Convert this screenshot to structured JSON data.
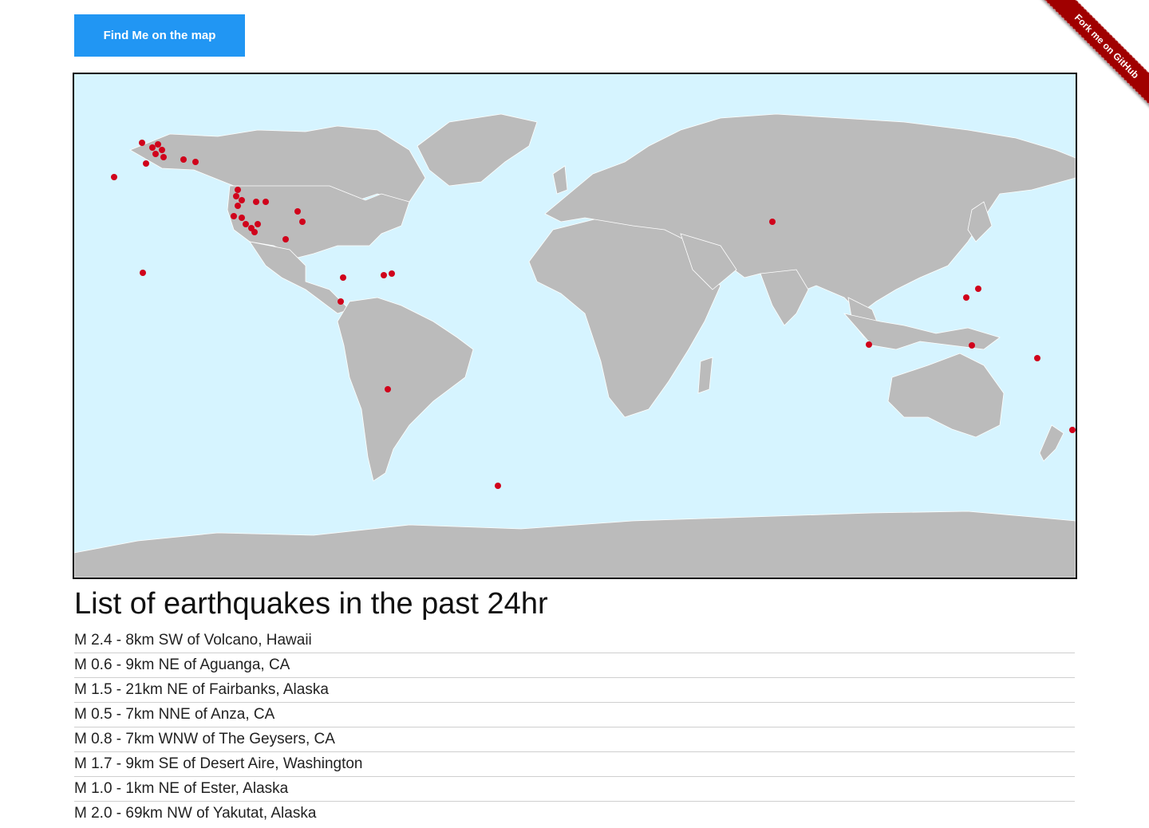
{
  "find_button": {
    "label": "Find Me on the map"
  },
  "ribbon": {
    "label": "Fork me on GitHub"
  },
  "map": {
    "ocean_color": "#d6f4ff",
    "land_color": "#bbbbbb",
    "marker_color": "#d0021b"
  },
  "list": {
    "title": "List of earthquakes in the past 24hr",
    "items": [
      "M 2.4 - 8km SW of Volcano, Hawaii",
      "M 0.6 - 9km NE of Aguanga, CA",
      "M 1.5 - 21km NE of Fairbanks, Alaska",
      "M 0.5 - 7km NNE of Anza, CA",
      "M 0.8 - 7km WNW of The Geysers, CA",
      "M 1.7 - 9km SE of Desert Aire, Washington",
      "M 1.0 - 1km NE of Ester, Alaska",
      "M 2.0 - 69km NW of Yakutat, Alaska"
    ]
  }
}
